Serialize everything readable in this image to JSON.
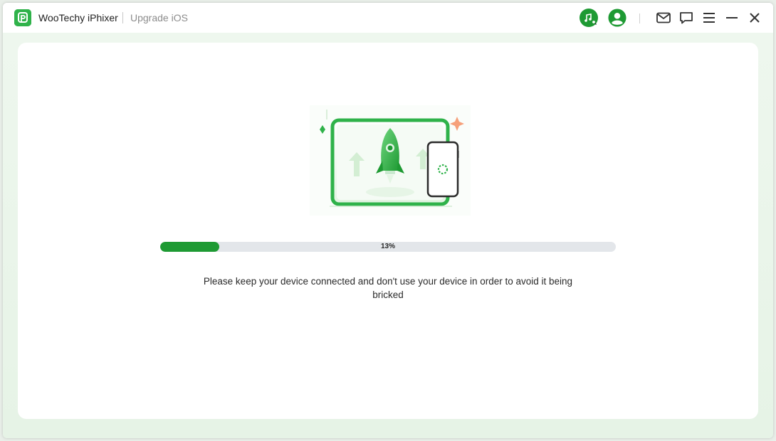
{
  "app": {
    "name": "WooTechy iPhixer",
    "module": "Upgrade iOS",
    "logo_icon": "app-logo-icon",
    "brand_color": "#2fb24a"
  },
  "toolbar": {
    "icons": [
      "music-search-icon",
      "user-account-icon",
      "mail-icon",
      "chat-icon",
      "menu-icon",
      "minimize-icon",
      "close-icon"
    ]
  },
  "progress": {
    "value": 0.13,
    "label": "13%",
    "fill_color": "#1e9a33",
    "track_color": "#e3e6ea"
  },
  "message": "Please keep your device connected and don't use your device in order to avoid it being bricked"
}
